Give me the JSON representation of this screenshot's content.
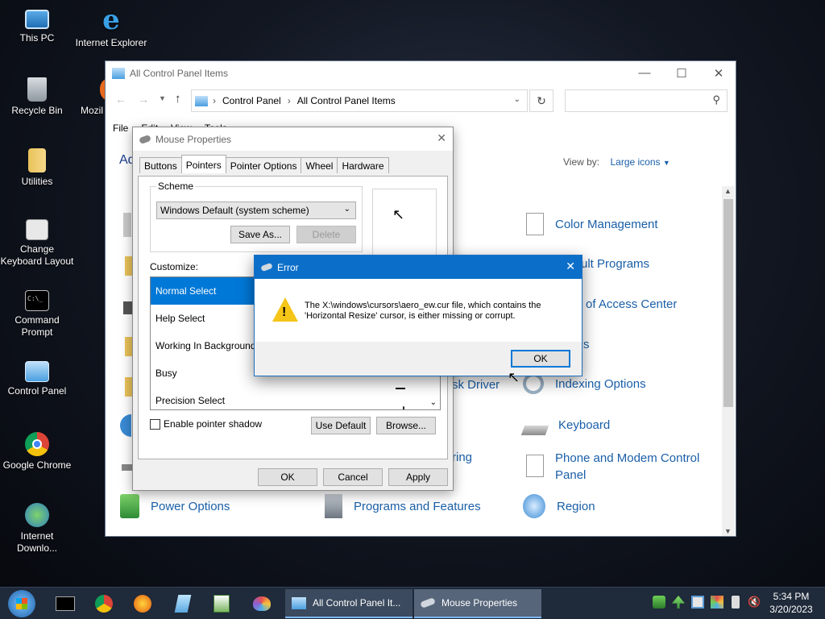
{
  "desktop": {
    "icons": [
      {
        "label": "This PC",
        "icon": "pc-icon"
      },
      {
        "label": "Internet Explorer",
        "icon": "ie-icon"
      },
      {
        "label": "Recycle Bin",
        "icon": "recycle-bin-icon"
      },
      {
        "label": "Mozil",
        "icon": "firefox-icon"
      },
      {
        "label": "Utilities",
        "icon": "folder-icon"
      },
      {
        "label": "Change Keyboard Layout",
        "icon": "keyboard-settings-icon"
      },
      {
        "label": "Command Prompt",
        "icon": "cmd-icon"
      },
      {
        "label": "Control Panel",
        "icon": "control-panel-icon"
      },
      {
        "label": "Google Chrome",
        "icon": "chrome-icon"
      },
      {
        "label": "Internet Downlo...",
        "icon": "idm-icon"
      }
    ]
  },
  "explorer": {
    "title": "All Control Panel Items",
    "breadcrumb": [
      "Control Panel",
      "All Control Panel Items"
    ],
    "menu_file": "File",
    "menu_edit": "Edit",
    "menu_view": "View",
    "menu_tools": "Tools",
    "heading_partial": "Ad",
    "view_by_label": "View by:",
    "view_by_value": "Large icons",
    "items": [
      {
        "label": "Color Management"
      },
      {
        "label": "ult Programs"
      },
      {
        "label": "of Access Center"
      },
      {
        "label": "s"
      },
      {
        "label": "sk Driver"
      },
      {
        "label": "Indexing Options"
      },
      {
        "label": "Keyboard"
      },
      {
        "label": "ring"
      },
      {
        "label": "Phone and Modem Control Panel"
      },
      {
        "label": "Power Options"
      },
      {
        "label": "Programs and Features"
      },
      {
        "label": "Region"
      }
    ]
  },
  "mouse": {
    "title": "Mouse Properties",
    "tabs": [
      "Buttons",
      "Pointers",
      "Pointer Options",
      "Wheel",
      "Hardware"
    ],
    "active_tab": "Pointers",
    "scheme_label": "Scheme",
    "scheme_value": "Windows Default (system scheme)",
    "save_as": "Save As...",
    "delete": "Delete",
    "customize_label": "Customize:",
    "list": [
      "Normal Select",
      "Help Select",
      "Working In Background",
      "Busy",
      "Precision Select"
    ],
    "shadow_label": "Enable pointer shadow",
    "use_default": "Use Default",
    "browse": "Browse...",
    "ok": "OK",
    "cancel": "Cancel",
    "apply": "Apply"
  },
  "error": {
    "title": "Error",
    "message_line1": "The X:\\windows\\cursors\\aero_ew.cur file, which contains the",
    "message_line2": "'Horizontal Resize' cursor, is either missing or corrupt.",
    "ok": "OK"
  },
  "taskbar": {
    "windows": [
      {
        "label": "All Control Panel It...",
        "icon": "control-panel-icon"
      },
      {
        "label": "Mouse Properties",
        "icon": "mouse-icon"
      }
    ],
    "time": "5:34 PM",
    "date": "3/20/2023"
  },
  "colors": {
    "accent": "#0078d7",
    "link": "#1a5fa8",
    "error_title": "#0b6fc9",
    "taskbar": "#1f2a3a"
  }
}
